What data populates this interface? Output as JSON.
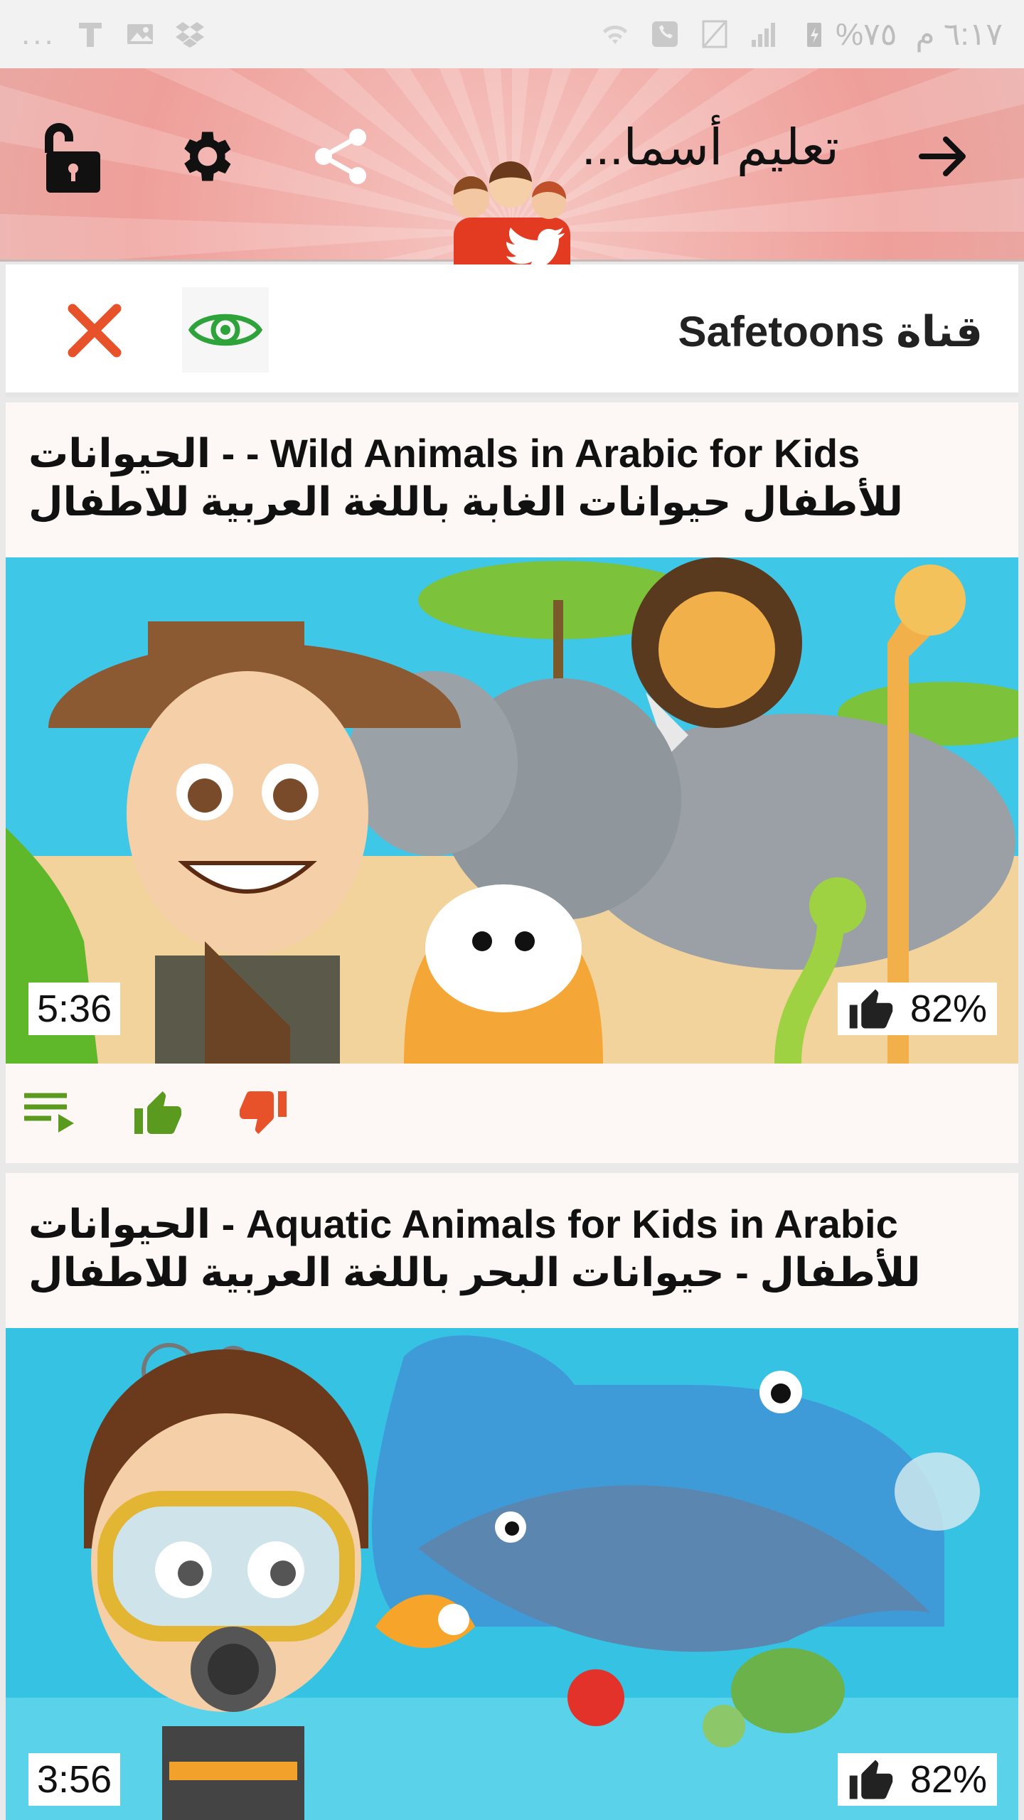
{
  "status_bar": {
    "time": "٦:١٧ م",
    "battery": "%٧٥",
    "overflow": "...",
    "icons_left": [
      "signal-icon",
      "sim-icon",
      "phone-icon",
      "wifi-icon"
    ],
    "icons_right": [
      "text-icon",
      "image-icon",
      "dropbox-icon"
    ]
  },
  "toolbar": {
    "title": "تعليم أسما...",
    "icons": [
      "unlock-icon",
      "settings-icon",
      "share-icon",
      "app-logo",
      "forward-arrow-icon"
    ]
  },
  "channel": {
    "title": "قناة Safetoons",
    "icons": [
      "close-icon",
      "eye-icon"
    ]
  },
  "videos": [
    {
      "title": "Wild Animals in Arabic for Kids - - الحيوانات للأطفال حيوانات الغابة باللغة العربية للاطفال",
      "duration": "5:36",
      "rating": "82%",
      "colors": {
        "sky": "#3fc7e8",
        "ground": "#f3d39c"
      }
    },
    {
      "title": "Aquatic Animals for Kids in Arabic - الحيوانات للأطفال - حيوانات البحر باللغة العربية للاطفال",
      "duration": "3:56",
      "rating": "82%",
      "colors": {
        "sky": "#35c2e3",
        "ground": "#5ad2ea"
      }
    }
  ],
  "accent": {
    "like": "#5a9a1f",
    "dislike": "#e8522a",
    "close": "#e8522a",
    "eye": "#2fa33b"
  }
}
